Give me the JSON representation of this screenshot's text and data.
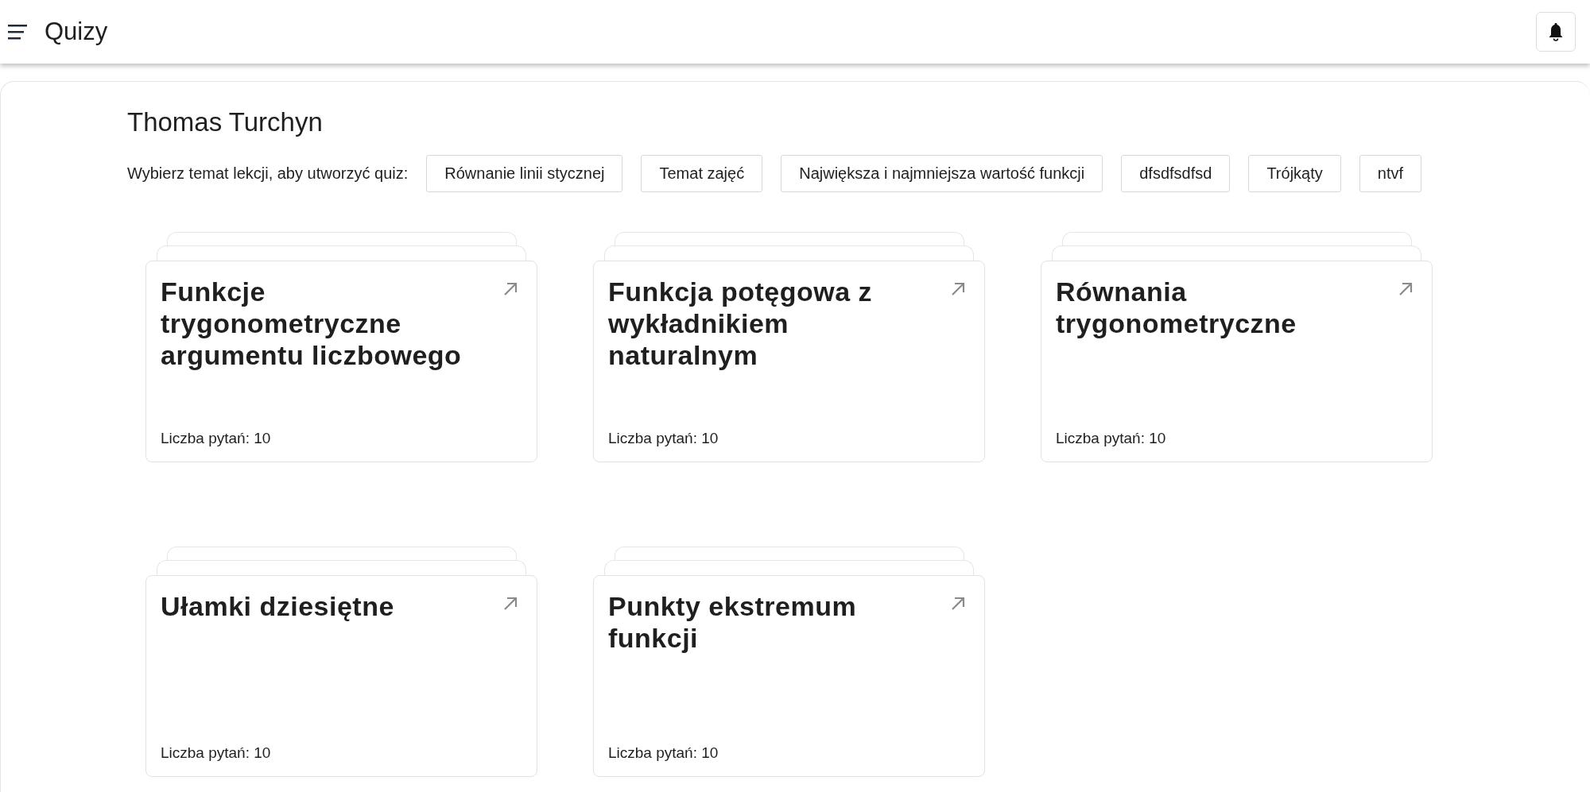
{
  "app_bar": {
    "title": "Quizy"
  },
  "user": {
    "name": "Thomas Turchyn"
  },
  "topics": {
    "prompt": "Wybierz temat lekcji, aby utworzyć quiz:",
    "items": [
      "Równanie linii stycznej",
      "Temat zajęć",
      "Największa i najmniejsza wartość funkcji",
      "dfsdfsdfsd",
      "Trójkąty",
      "ntvf"
    ]
  },
  "quizzes": [
    {
      "title": "Funkcje trygonometryczne argumentu liczbowego",
      "count": "Liczba pytań: 10"
    },
    {
      "title": "Funkcja potęgowa z wykładnikiem naturalnym",
      "count": "Liczba pytań: 10"
    },
    {
      "title": "Równania trygonometryczne",
      "count": "Liczba pytań: 10"
    },
    {
      "title": "Ułamki dziesiętne",
      "count": "Liczba pytań: 10"
    },
    {
      "title": "Punkty ekstremum funkcji",
      "count": "Liczba pytań: 10"
    }
  ]
}
